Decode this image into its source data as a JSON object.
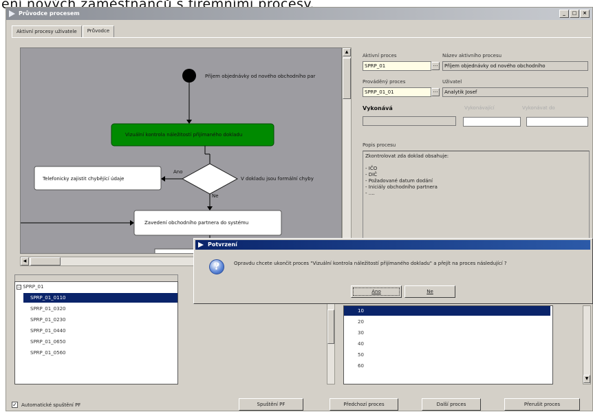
{
  "caption_text": "ení nových zaměstnanců s firemními procesy.",
  "window": {
    "title": "Průvodce procesem",
    "buttons": [
      "_",
      "□",
      "×"
    ]
  },
  "tabs": [
    {
      "label": "Aktivní procesy uživatele"
    },
    {
      "label": "Průvodce"
    }
  ],
  "diagram": {
    "start_label": "Příjem objednávky od nového obchodního par",
    "green_box": "Vizuální kontrola náležitostí přijímaného dokladu",
    "decision_label": "V dokladu jsou formální chyby",
    "yes_label": "Ano",
    "no_label": "Ne",
    "left_box": "Telefonicky zajistit chybějící údaje",
    "bottom_box": "Zavedení obchodního partnera do systému"
  },
  "right_panel": {
    "active_process_label": "Aktivní proces",
    "active_process_value": "SPRP_01",
    "active_name_label": "Název aktivního procesu",
    "active_name_value": "Příjem objednávky od nového obchodního",
    "executed_label": "Prováděný proces",
    "executed_value": "SPRP_01_01",
    "user_label": "Uživatel",
    "user_value": "Analytik Josef",
    "executor_label": "Vykonává",
    "hint1": "Vykonávající",
    "hint2": "Vykonávat do",
    "desc_label": "Popis procesu",
    "desc_text": "Zkontrolovat zda doklad obsahuje:\n\n- IČO\n- DIČ\n- Požadované datum dodání\n- Iniciály obchodního partnera\n- ...."
  },
  "tree": {
    "root": "SPRP_01",
    "items": [
      "SPRP_01_0110",
      "SPRP_01_0320",
      "SPRP_01_0230",
      "SPRP_01_0440",
      "SPRP_01_0650",
      "SPRP_01_0560"
    ],
    "selected_index": 0
  },
  "list2": {
    "items": [
      "10",
      "20",
      "30",
      "40",
      "50",
      "60"
    ],
    "selected_index": 0
  },
  "bottom": {
    "checkbox_label": "Automatické spuštění PF",
    "checkbox_checked": "✓",
    "buttons": [
      "Spuštění PF",
      "Předchozí proces",
      "Další proces",
      "Přerušit proces"
    ]
  },
  "dialog": {
    "title": "Potvrzení",
    "message": "Opravdu chcete ukončit proces \"Vizuální kontrola náležitostí přijímaného dokladu\" a přejít na proces následující ?",
    "yes": "Ano",
    "no": "Ne",
    "icon": "?"
  }
}
